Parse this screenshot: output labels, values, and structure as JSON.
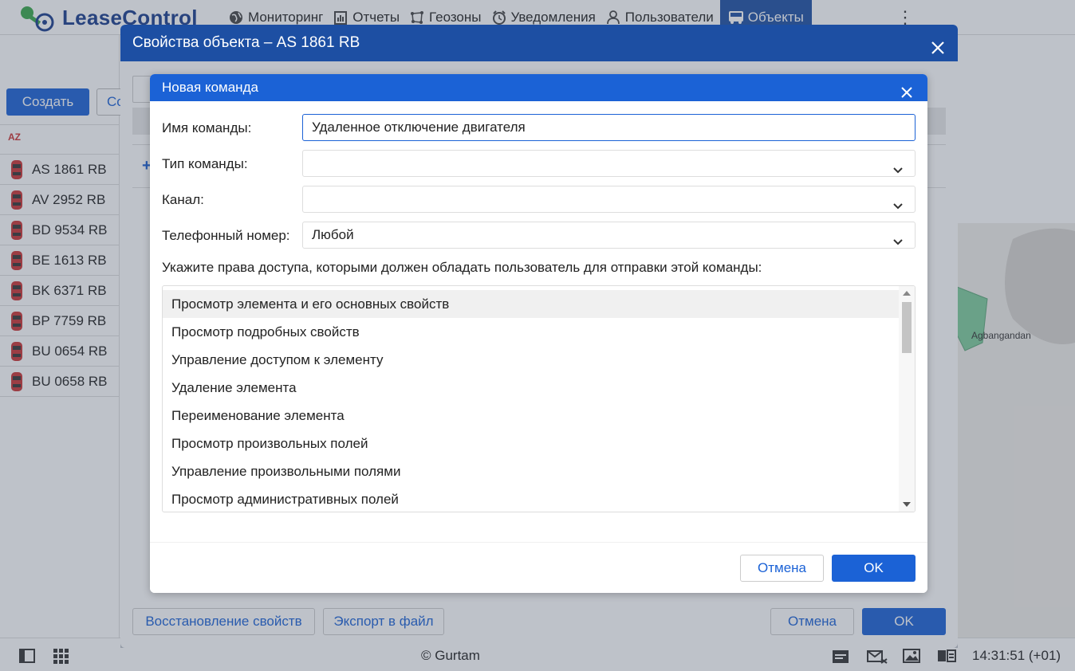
{
  "app": {
    "logo_text": "LeaseControl"
  },
  "nav": [
    {
      "label": "Мониторинг",
      "icon": "globe-icon"
    },
    {
      "label": "Отчеты",
      "icon": "report-icon"
    },
    {
      "label": "Геозоны",
      "icon": "geofence-icon"
    },
    {
      "label": "Уведомления",
      "icon": "alarm-clock-icon"
    },
    {
      "label": "Пользователи",
      "icon": "user-icon"
    },
    {
      "label": "Объекты",
      "icon": "bus-icon",
      "active": true
    }
  ],
  "left_panel": {
    "create_label": "Создать",
    "second_button_label": "Со",
    "sort_label": "AZ",
    "units": [
      "AS 1861 RB",
      "AV 2952 RB",
      "BD 9534 RB",
      "BE 1613 RB",
      "BK 6371 RB",
      "BP 7759 RB",
      "BU 0654 RB",
      "BU 0658 RB"
    ]
  },
  "map": {
    "place_label": "Agbangandan"
  },
  "footer": {
    "copyright": "© Gurtam",
    "clock": "14:31:51 (+01)"
  },
  "outer_dialog": {
    "title": "Свойства объекта – AS 1861 RB",
    "restore_label": "Восстановление свойств",
    "export_label": "Экспорт в файл",
    "cancel_label": "Отмена",
    "ok_label": "OK"
  },
  "dialog": {
    "title": "Новая команда",
    "fields": {
      "name_label": "Имя команды:",
      "name_value": "Удаленное отключение двигателя",
      "type_label": "Тип команды:",
      "type_value": "",
      "channel_label": "Канал:",
      "channel_value": "",
      "phone_label": "Телефонный номер:",
      "phone_value": "Любой"
    },
    "permissions_title": "Укажите права доступа, которыми должен обладать пользователь для отправки этой команды:",
    "permissions": [
      "Просмотр элемента и его основных свойств",
      "Просмотр подробных свойств",
      "Управление доступом к элементу",
      "Удаление элемента",
      "Переименование элемента",
      "Просмотр произвольных полей",
      "Управление произвольными полями",
      "Просмотр административных полей"
    ],
    "cancel_label": "Отмена",
    "ok_label": "OK"
  },
  "colors": {
    "primary": "#1b62d6",
    "header_blue": "#1d4fa3",
    "overlay": "rgba(70,80,100,0.35)"
  }
}
